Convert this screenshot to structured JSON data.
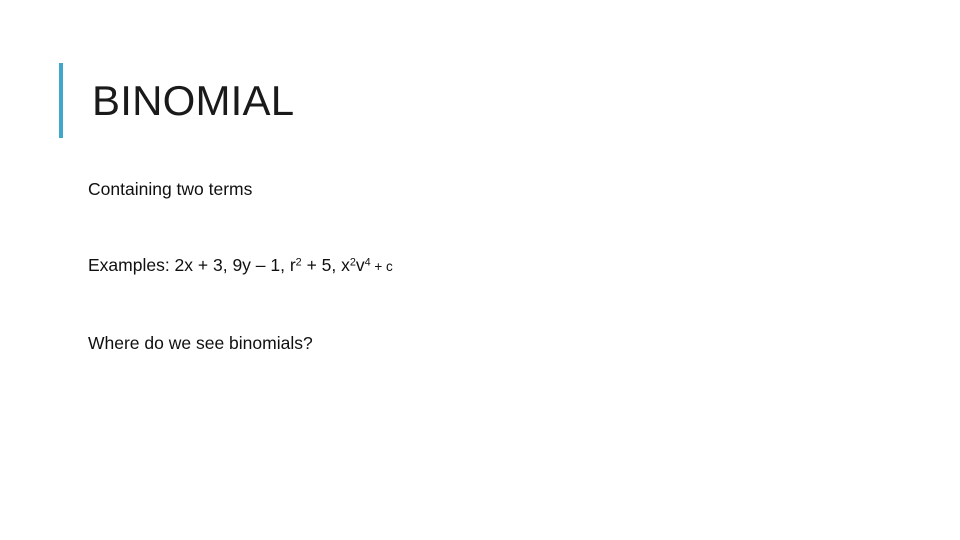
{
  "slide": {
    "background_color": "#ffffff",
    "accent_color": "#3FA7C9",
    "text_color": "#101010",
    "title_color": "#1A1A1A",
    "title": "BINOMIAL",
    "body_lines": [
      {
        "id": "definition",
        "text": "Containing two terms"
      },
      {
        "id": "examples",
        "prefix": "Examples: 2x + 3, 9y – 1, r",
        "sup1": "2",
        "mid": " + 5, x",
        "sup2": "2",
        "mid2": "v",
        "sup3": "4",
        "tail": " + c"
      },
      {
        "id": "question",
        "text": "Where do we see binomials?"
      }
    ]
  }
}
